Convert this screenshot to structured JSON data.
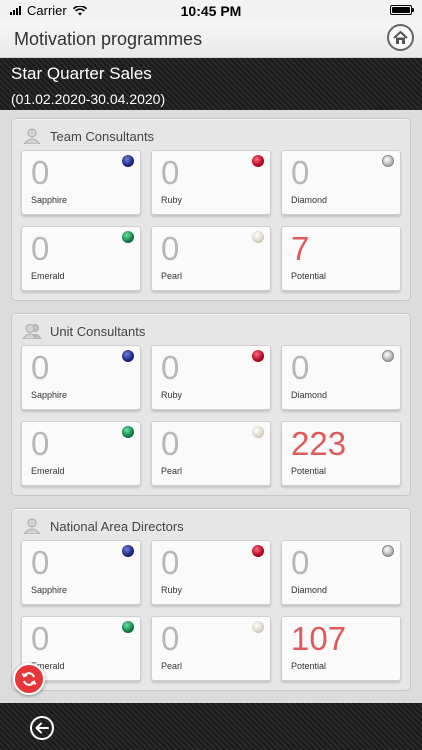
{
  "status_bar": {
    "carrier": "Carrier",
    "time": "10:45 PM"
  },
  "header": {
    "title": "Motivation programmes"
  },
  "programme": {
    "title": "Star Quarter Sales",
    "period": "(01.02.2020-30.04.2020)"
  },
  "colors": {
    "potential": "#e05a5a",
    "refresh": "#e6363a"
  },
  "sections": [
    {
      "title": "Team Consultants",
      "tiles": [
        {
          "value": "0",
          "label": "Sapphire",
          "icon": "sapphire-gem-icon"
        },
        {
          "value": "0",
          "label": "Ruby",
          "icon": "ruby-gem-icon"
        },
        {
          "value": "0",
          "label": "Diamond",
          "icon": "diamond-gem-icon"
        },
        {
          "value": "0",
          "label": "Emerald",
          "icon": "emerald-gem-icon"
        },
        {
          "value": "0",
          "label": "Pearl",
          "icon": "pearl-gem-icon"
        },
        {
          "value": "7",
          "label": "Potential"
        }
      ]
    },
    {
      "title": "Unit Consultants",
      "tiles": [
        {
          "value": "0",
          "label": "Sapphire",
          "icon": "sapphire-gem-icon"
        },
        {
          "value": "0",
          "label": "Ruby",
          "icon": "ruby-gem-icon"
        },
        {
          "value": "0",
          "label": "Diamond",
          "icon": "diamond-gem-icon"
        },
        {
          "value": "0",
          "label": "Emerald",
          "icon": "emerald-gem-icon"
        },
        {
          "value": "0",
          "label": "Pearl",
          "icon": "pearl-gem-icon"
        },
        {
          "value": "223",
          "label": "Potential"
        }
      ]
    },
    {
      "title": "National Area Directors",
      "tiles": [
        {
          "value": "0",
          "label": "Sapphire",
          "icon": "sapphire-gem-icon"
        },
        {
          "value": "0",
          "label": "Ruby",
          "icon": "ruby-gem-icon"
        },
        {
          "value": "0",
          "label": "Diamond",
          "icon": "diamond-gem-icon"
        },
        {
          "value": "0",
          "label": "Emerald",
          "icon": "emerald-gem-icon"
        },
        {
          "value": "0",
          "label": "Pearl",
          "icon": "pearl-gem-icon"
        },
        {
          "value": "107",
          "label": "Potential"
        }
      ]
    }
  ]
}
